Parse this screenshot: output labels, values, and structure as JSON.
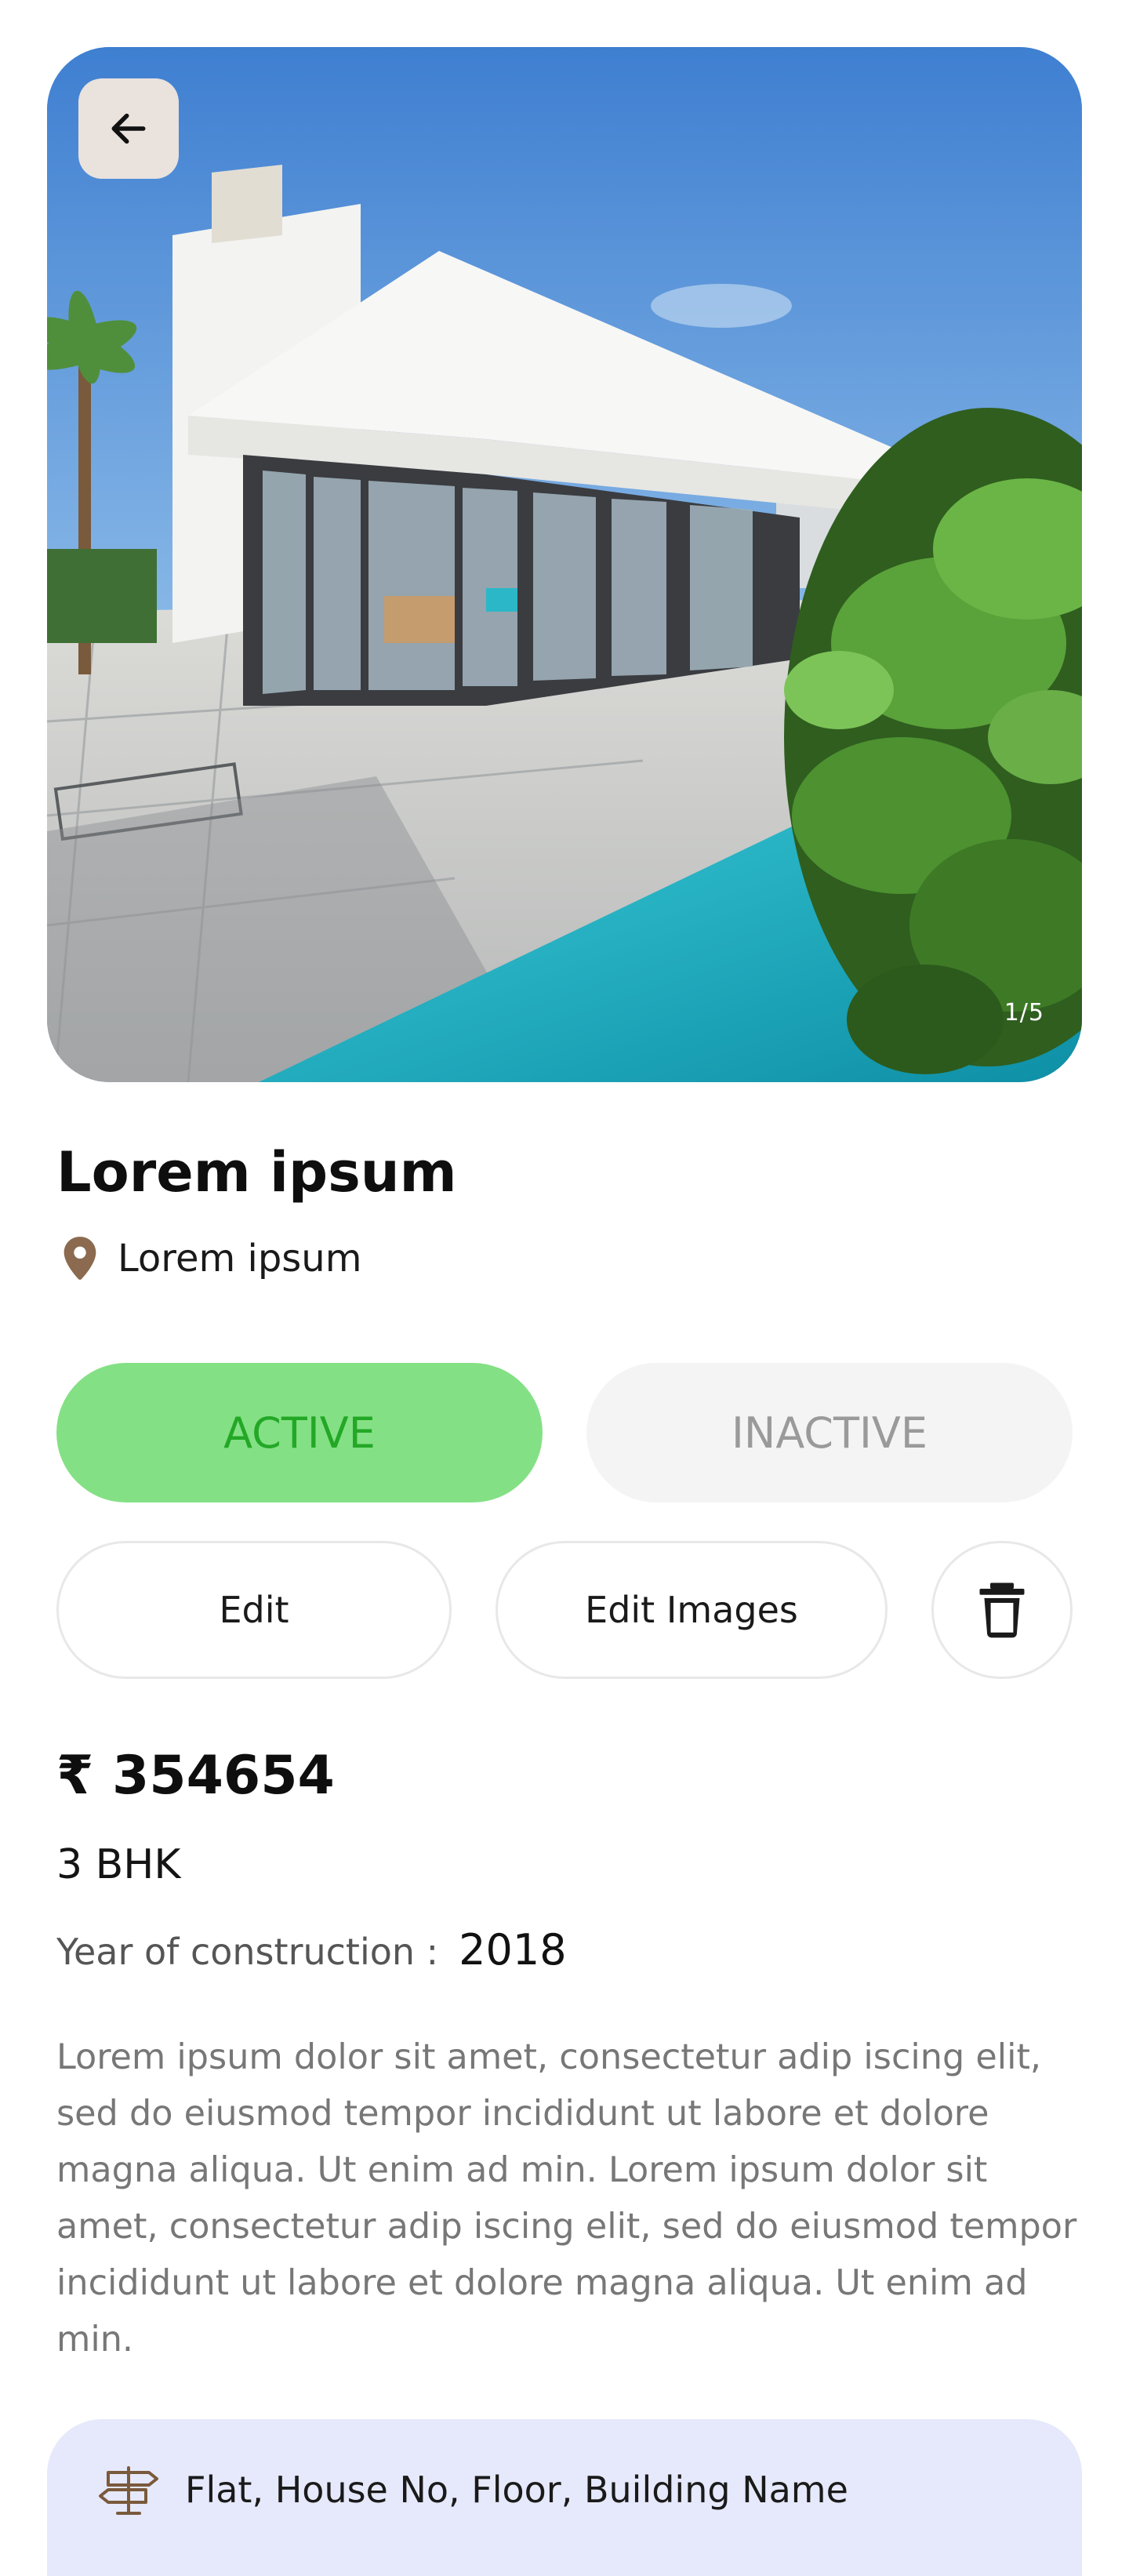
{
  "hero": {
    "back_icon": "arrow-left-icon",
    "image_counter": "1/5",
    "image_subject": "modern white villa with pool"
  },
  "listing": {
    "title": "Lorem ipsum",
    "location_icon": "map-pin-icon",
    "location": "Lorem ipsum"
  },
  "status": {
    "active_label": "ACTIVE",
    "inactive_label": "INACTIVE",
    "selected": "ACTIVE",
    "active_color": "#84e085",
    "active_text_color": "#23a826"
  },
  "actions": {
    "edit_label": "Edit",
    "edit_images_label": "Edit Images",
    "delete_icon": "trash-icon"
  },
  "details": {
    "price": "₹ 354654",
    "bhk": "3 BHK",
    "year_label": "Year of construction :",
    "year_value": "2018",
    "description": "Lorem ipsum dolor sit amet, consectetur adip iscing elit, sed do eiusmod tempor incididunt ut labore et dolore magna aliqua. Ut enim ad min. Lorem ipsum dolor sit amet, consectetur adip iscing elit, sed do eiusmod tempor incididunt ut labore et dolore magna aliqua. Ut enim ad min."
  },
  "address": {
    "icon": "signpost-icon",
    "label": "Flat, House No, Floor, Building Name",
    "card_color": "#e6e9fb"
  }
}
